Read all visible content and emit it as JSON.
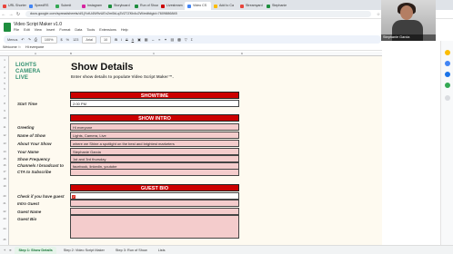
{
  "browser": {
    "tabs": [
      {
        "label": "URL Shorten",
        "color": "#e8453c"
      },
      {
        "label": "SpeedRS",
        "color": "#4285f4"
      },
      {
        "label": "Submit",
        "color": "#34a853"
      },
      {
        "label": "Instagram",
        "color": "#d6249f"
      },
      {
        "label": "Storyboard",
        "color": "#1e8e3e"
      },
      {
        "label": "Run of Show",
        "color": "#1e8e3e"
      },
      {
        "label": "Livestream",
        "color": "#cc0000"
      },
      {
        "label": "Video CS",
        "color": "#4285f4"
      },
      {
        "label": "Add to Ca",
        "color": "#fbbc04"
      },
      {
        "label": "Streamyard",
        "color": "#e8453c"
      },
      {
        "label": "Stephanie",
        "color": "#1e8e3e"
      }
    ],
    "url": "docs.google.com/spreadsheets/d/1jYctU4W9vUEx2m0kLq3VZ7ZKb4c2W/edit#gid=7609886845"
  },
  "sheets": {
    "title": "Video Script Maker v1.0",
    "menus": [
      "File",
      "Edit",
      "View",
      "Insert",
      "Format",
      "Data",
      "Tools",
      "Extensions",
      "Help"
    ],
    "toolbar": {
      "menus_label": "Menus",
      "zoom": "100%",
      "currency": "$",
      "percent": "%",
      "number_format": "123",
      "font": "Arial",
      "font_size": "10",
      "bold": "B",
      "italic": "I",
      "strike": "S",
      "text_color": "A"
    },
    "name_box": "Welcome",
    "formula_value": "Hi everyone",
    "columns": [
      "A",
      "B",
      "C",
      "D"
    ],
    "rows": [
      "1",
      "2",
      "3",
      "4",
      "5",
      "6",
      "7",
      "8",
      "9",
      "10",
      "11",
      "12",
      "13",
      "14",
      "15",
      "16",
      "17",
      "18",
      "19",
      "20",
      "21",
      "22",
      "23",
      "24",
      "25"
    ]
  },
  "content": {
    "logo_lines": [
      "LIGHTS",
      "CAMERA",
      "LIVE"
    ],
    "title": "Show Details",
    "subtitle": "Enter show details to populate Video Script Maker™.",
    "sections": {
      "showtime": "SHOWTIME",
      "show_intro": "SHOW INTRO",
      "guest_bio": "GUEST BIO"
    },
    "labels": {
      "start_time": "Start Time",
      "greeting": "Greeting",
      "name_of_show": "Name of Show",
      "about_show": "About Your Show",
      "your_name": "Your Name",
      "show_frequency": "Show Frequency",
      "channels": "Channels I broadcast to",
      "cta": "CTA to Subscribe",
      "check_guest": "Check if you have guest",
      "intro_guest": "Intro Guest",
      "guest_name": "Guest Name",
      "guest_bio": "Guest Bio"
    },
    "values": {
      "start_time": "2:00 PM",
      "greeting": "Hi everyone",
      "name_of_show": "Lights, Camera, Live",
      "about_show": "where we Shine a spotlight on the best and brightest marketers",
      "your_name": "Stephanie Garcia",
      "show_frequency": "1st and 3rd thursday",
      "channels": "facebook, linkedin, youtube",
      "cta": "",
      "check_guest": "✓",
      "intro_guest": "",
      "guest_name": "",
      "guest_bio": ""
    }
  },
  "sheet_tabs": [
    "Step 1: Show Details",
    "Step 2: Video Script Maker",
    "Step 3: Run of Show",
    "Lists"
  ],
  "webcam": {
    "name": "Stephanie Garcia"
  },
  "colors": {
    "accent_red": "#cc0000",
    "field_pink": "#f4cccc",
    "logo_green": "#2e8e6e",
    "sheet_bg": "#fefaf0"
  }
}
